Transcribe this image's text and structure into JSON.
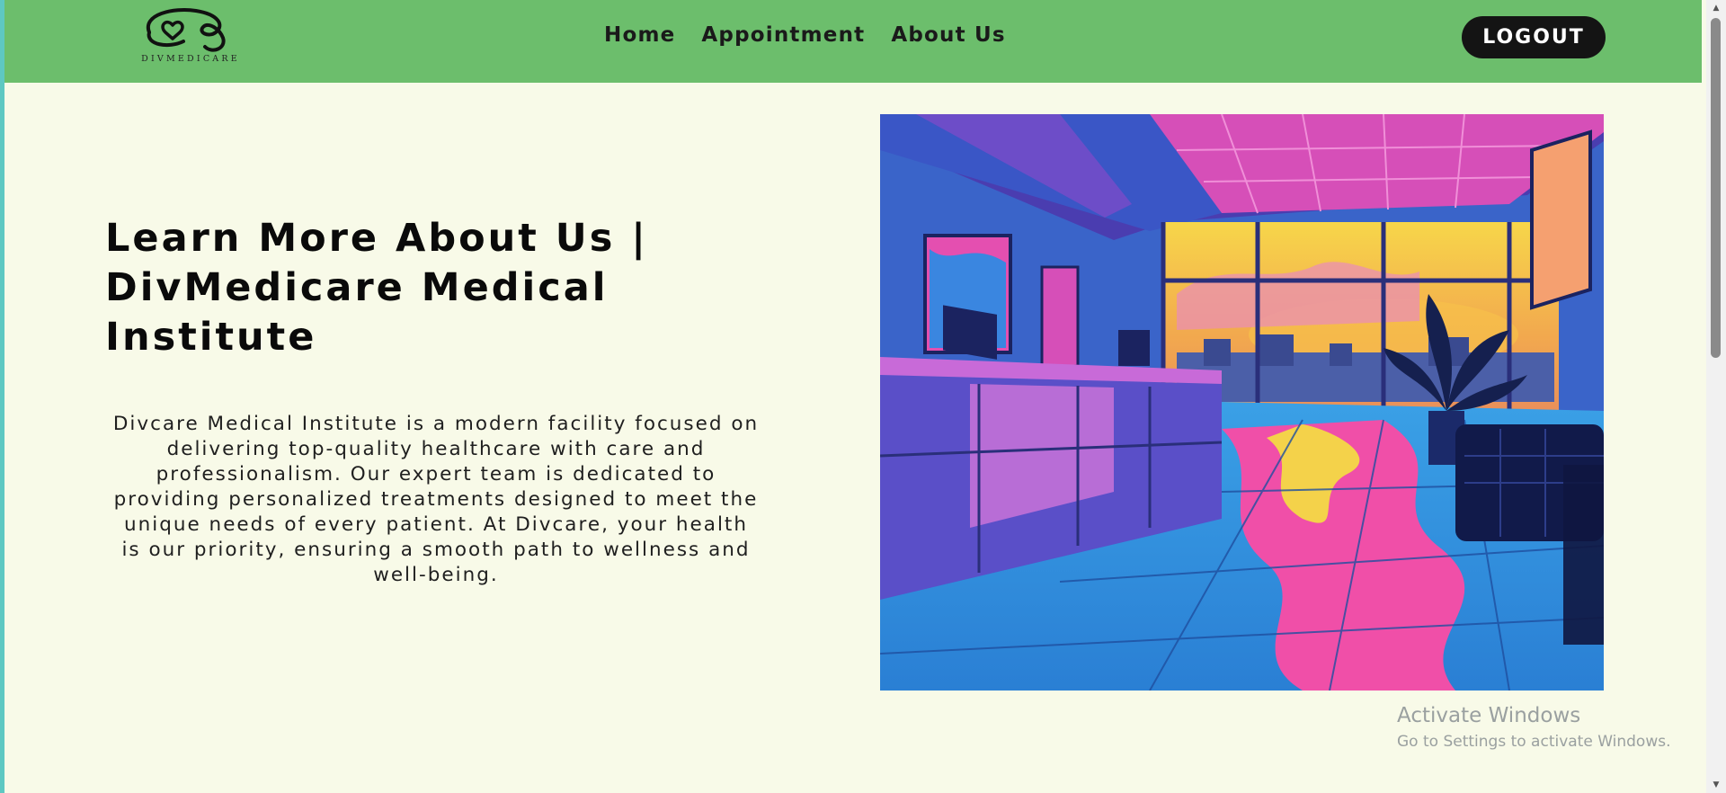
{
  "header": {
    "logo_text": "DIVMEDICARE",
    "nav": {
      "home": "Home",
      "appointment": "Appointment",
      "about": "About Us"
    },
    "logout_label": "LOGOUT"
  },
  "main": {
    "heading": "Learn More About Us | DivMedicare Medical Institute",
    "description": "Divcare Medical Institute is a modern facility focused on delivering top-quality healthcare with care and professionalism. Our expert team is dedicated to providing personalized treatments designed to meet the unique needs of every patient. At Divcare, your health is our priority, ensuring a smooth path to wellness and well-being."
  },
  "watermark": {
    "title": "Activate Windows",
    "subtitle": "Go to Settings to activate Windows."
  },
  "colors": {
    "navbar": "#6cbe6c",
    "page_background": "#f8fae8",
    "logout_button": "#141414"
  }
}
